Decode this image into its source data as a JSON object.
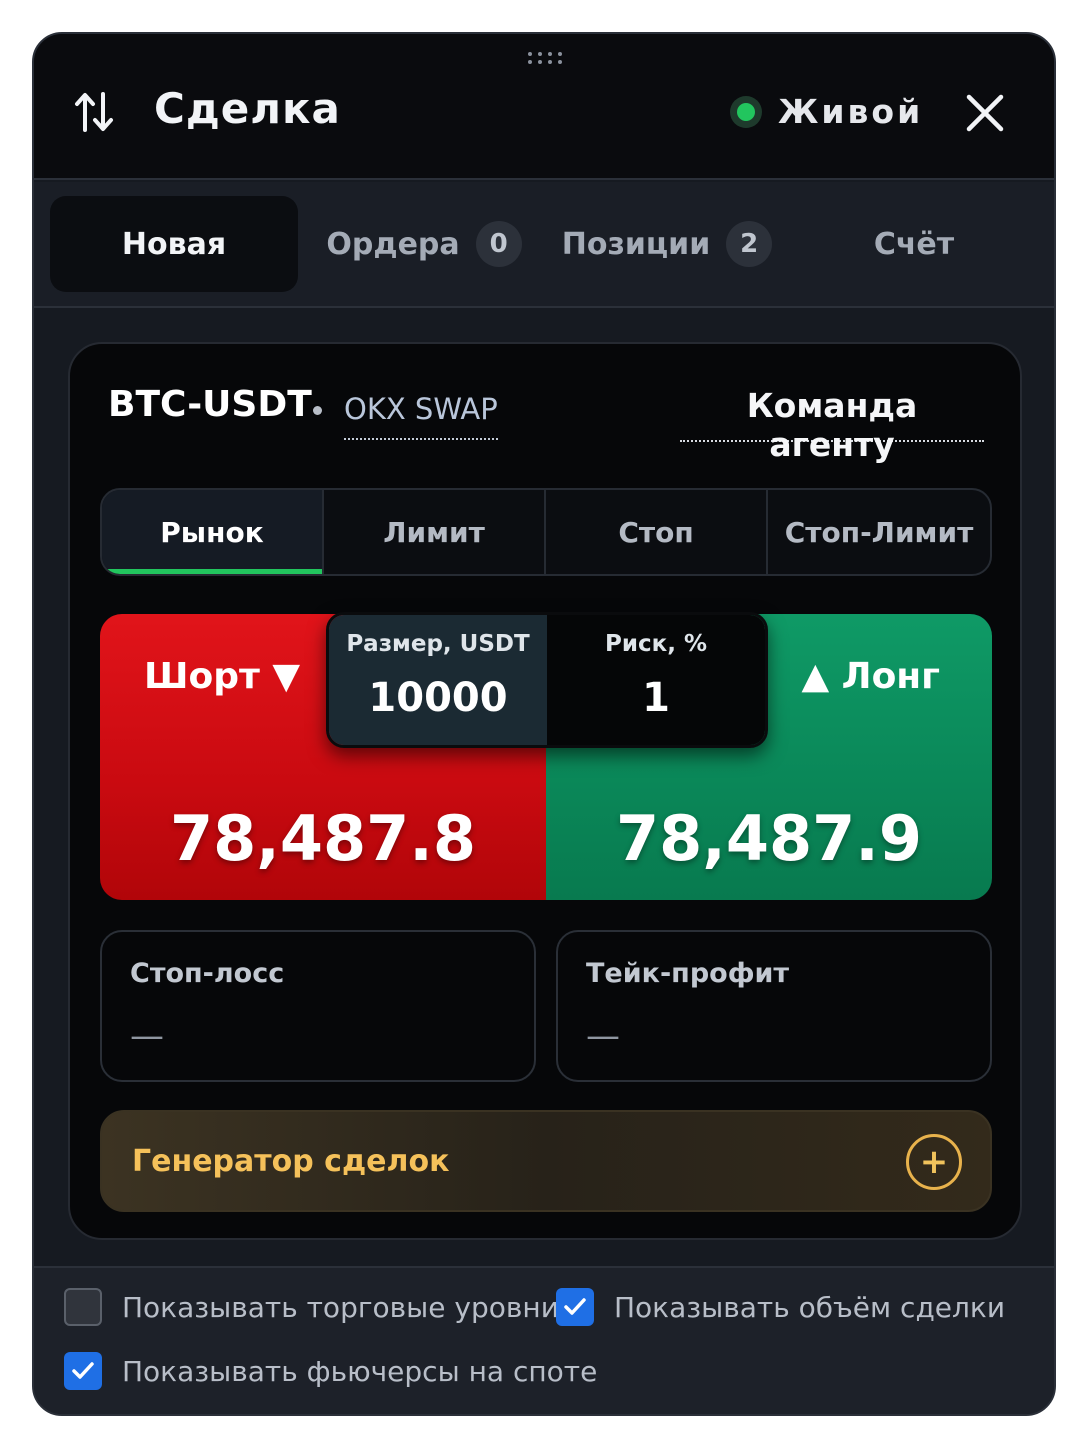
{
  "header": {
    "title": "Сделка",
    "status_label": "Живой",
    "status_color": "#22c55e",
    "icons": [
      "swap-vertical-icon",
      "close-icon",
      "drag-grip-icon"
    ]
  },
  "tabs": [
    {
      "label": "Новая",
      "active": true
    },
    {
      "label": "Ордера",
      "count": "0"
    },
    {
      "label": "Позиции",
      "count": "2"
    },
    {
      "label": "Счёт"
    }
  ],
  "instrument": {
    "symbol": "BTC-USDT",
    "exchange": "OKX SWAP",
    "agent_command_label": "Команда агенту"
  },
  "order_types": [
    {
      "label": "Рынок",
      "active": true
    },
    {
      "label": "Лимит"
    },
    {
      "label": "Стоп"
    },
    {
      "label": "Стоп-Лимит"
    }
  ],
  "trade": {
    "short_label": "Шорт ▼",
    "short_price": "78,487.8",
    "long_label": "▲ Лонг",
    "long_price": "78,487.9",
    "size_label": "Размер, USDT",
    "size_value": "10000",
    "risk_label": "Риск, %",
    "risk_value": "1",
    "short_color": "#d10f15",
    "long_color": "#0b8f5e"
  },
  "protection": {
    "stop_loss_label": "Стоп-лосс",
    "stop_loss_value": "—",
    "take_profit_label": "Тейк-профит",
    "take_profit_value": "—"
  },
  "generator": {
    "label": "Генератор сделок",
    "accent_color": "#f5c15a"
  },
  "options": [
    {
      "label": "Показывать торговые уровни",
      "checked": false
    },
    {
      "label": "Показывать объём сделки",
      "checked": true
    },
    {
      "label": "Показывать фьючерсы на споте",
      "checked": true
    }
  ]
}
